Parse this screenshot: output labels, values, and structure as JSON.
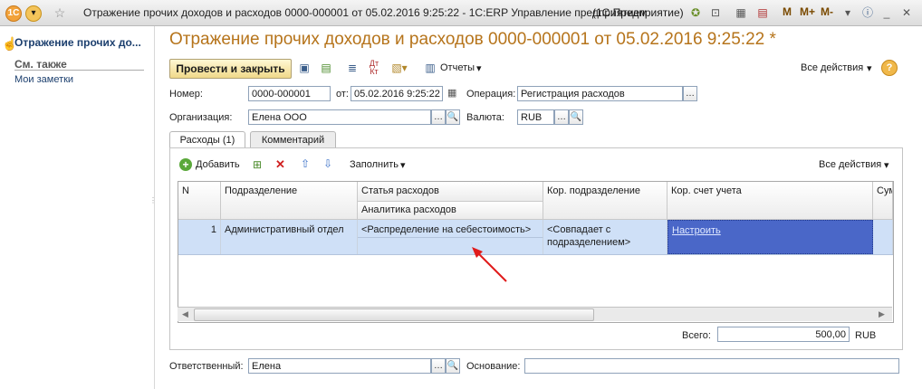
{
  "window": {
    "title": "Отражение прочих доходов и расходов 0000-000001 от 05.02.2016 9:25:22 - 1С:ERP Управление предприятием",
    "app_tag": "(1С:Предприятие)",
    "btn_m": "M",
    "btn_mplus": "M+",
    "btn_mminus": "M-"
  },
  "nav": {
    "active": "Отражение прочих до...",
    "section": "См. также",
    "link": "Мои заметки"
  },
  "doc": {
    "title": "Отражение прочих доходов и расходов 0000-000001 от 05.02.2016 9:25:22 *",
    "post_close": "Провести и закрыть",
    "reports": "Отчеты",
    "all_actions": "Все действия",
    "help": "?"
  },
  "form": {
    "number_label": "Номер:",
    "number_value": "0000-000001",
    "date_label": "от:",
    "date_value": "05.02.2016  9:25:22",
    "operation_label": "Операция:",
    "operation_value": "Регистрация расходов",
    "org_label": "Организация:",
    "org_value": "Елена ООО",
    "currency_label": "Валюта:",
    "currency_value": "RUB",
    "responsible_label": "Ответственный:",
    "responsible_value": "Елена",
    "basis_label": "Основание:",
    "basis_value": ""
  },
  "tabs": [
    {
      "label": "Расходы (1)"
    },
    {
      "label": "Комментарий"
    }
  ],
  "grid_toolbar": {
    "add": "Добавить",
    "fill": "Заполнить",
    "all_actions": "Все действия"
  },
  "grid": {
    "headers": [
      "N",
      "Подразделение",
      "Статья расходов",
      "Кор. подразделение",
      "Кор. счет учета",
      "Сум"
    ],
    "subheader": "Аналитика расходов",
    "row": {
      "n": "1",
      "division": "Административный отдел",
      "expense_item": "<Распределение на себестоимость>",
      "cor_division": "<Совпадает с подразделением>",
      "cor_account": "Настроить"
    }
  },
  "totals": {
    "label": "Всего:",
    "value": "500,00",
    "currency": "RUB"
  },
  "colors": {
    "title": "#b6741b",
    "selected_row": "#cfe0f7",
    "selected_cell": "#4a67c8",
    "arrow": "#e01b1b"
  }
}
